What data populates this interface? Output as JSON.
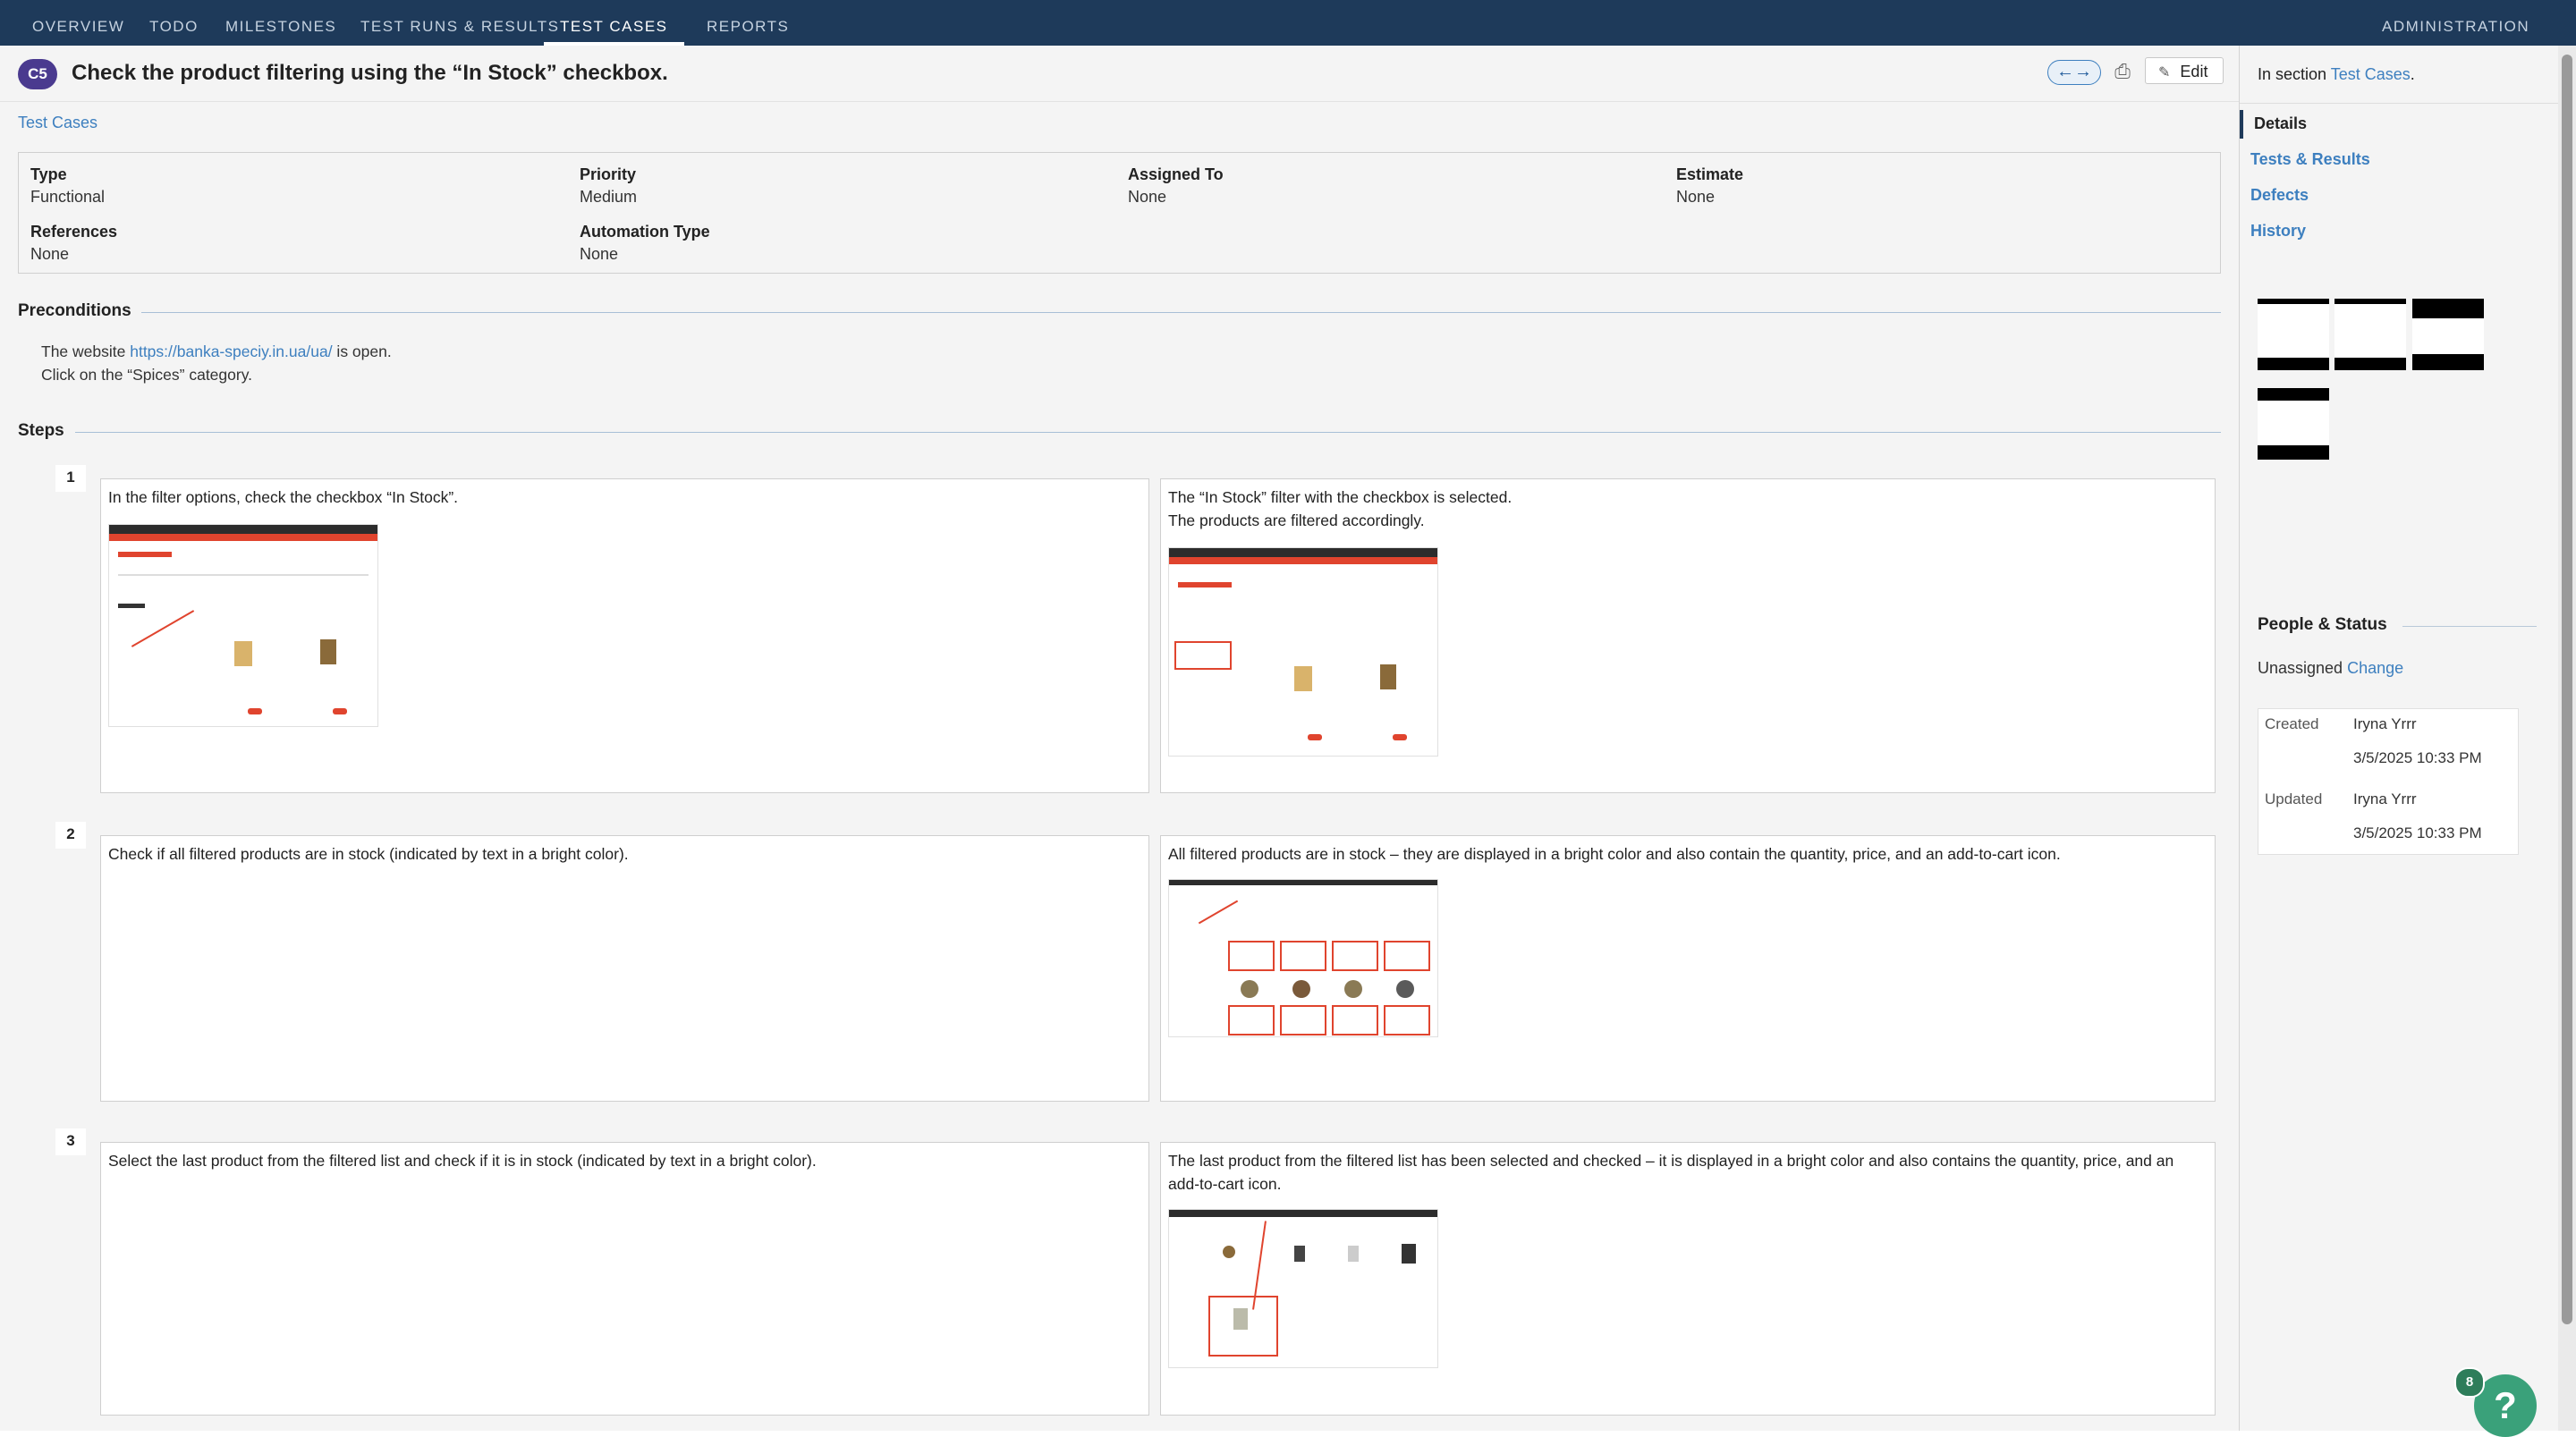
{
  "nav": {
    "tabs": [
      "OVERVIEW",
      "TODO",
      "MILESTONES",
      "TEST RUNS & RESULTS",
      "TEST CASES",
      "REPORTS"
    ],
    "active_tab": "TEST CASES",
    "admin": "ADMINISTRATION"
  },
  "header": {
    "case_id": "C5",
    "title": "Check the product filtering using the “In Stock” checkbox.",
    "edit_label": "Edit",
    "breadcrumb": "Test Cases"
  },
  "details": {
    "type_label": "Type",
    "type_value": "Functional",
    "priority_label": "Priority",
    "priority_value": "Medium",
    "assigned_label": "Assigned To",
    "assigned_value": "None",
    "estimate_label": "Estimate",
    "estimate_value": "None",
    "references_label": "References",
    "references_value": "None",
    "automation_label": "Automation Type",
    "automation_value": "None"
  },
  "preconditions": {
    "title": "Preconditions",
    "line1_prefix": "The website ",
    "line1_link": "https://banka-speciy.in.ua/ua/",
    "line1_suffix": " is open.",
    "line2": "Click on the “Spices” category."
  },
  "steps": {
    "title": "Steps",
    "items": [
      {
        "num": "1",
        "action": "In the filter options, check the checkbox “In Stock”.",
        "expected_line1": "The “In Stock” filter with the checkbox is selected.",
        "expected_line2": "The products are filtered accordingly."
      },
      {
        "num": "2",
        "action": "Check if all filtered products are in stock (indicated by text in a bright color).",
        "expected": "All filtered products are in stock – they are displayed in a bright color and also contain the quantity, price, and an add-to-cart icon."
      },
      {
        "num": "3",
        "action": "Select the last product from the filtered list and check if it is in stock (indicated by text in a bright color).",
        "expected": "The last product from the filtered list has been selected and checked – it is displayed in a bright color and also contains the quantity, price, and an add-to-cart icon."
      }
    ]
  },
  "sidebar": {
    "section_prefix": "In section ",
    "section_link": "Test Cases",
    "section_suffix": ".",
    "tabs": [
      "Details",
      "Tests & Results",
      "Defects",
      "History"
    ],
    "people_title": "People & Status",
    "assign_status": "Unassigned",
    "change_label": "Change",
    "created_label": "Created",
    "created_by": "Iryna Yrrr",
    "created_at": "3/5/2025 10:33 PM",
    "updated_label": "Updated",
    "updated_by": "Iryna Yrrr",
    "updated_at": "3/5/2025 10:33 PM"
  },
  "help": {
    "badge_count": "8",
    "icon": "?"
  },
  "colors": {
    "nav_bg": "#1e3a5a",
    "link": "#3d7fbf",
    "badge": "#4a3a8f",
    "help": "#3aa17a",
    "site_accent": "#e0442e"
  }
}
